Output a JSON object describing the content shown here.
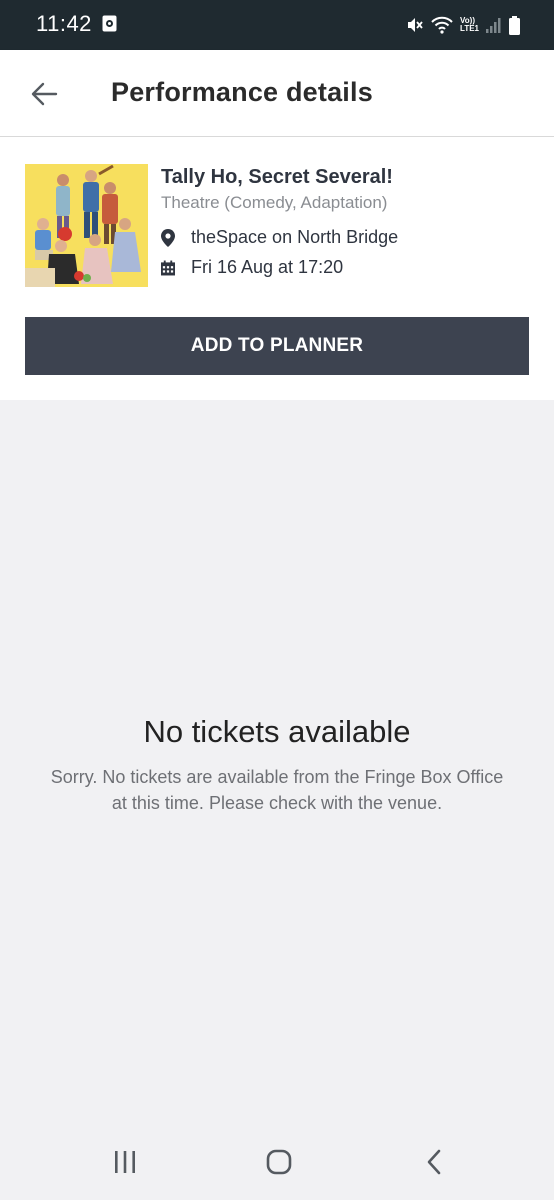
{
  "status_bar": {
    "time": "11:42",
    "network_label_top": "Vo))",
    "network_label_bottom": "LTE1"
  },
  "app_bar": {
    "title": "Performance details"
  },
  "performance": {
    "title": "Tally Ho, Secret Several!",
    "genre": "Theatre (Comedy, Adaptation)",
    "venue": "theSpace on North Bridge",
    "datetime": "Fri 16 Aug at 17:20",
    "add_button_label": "ADD TO PLANNER"
  },
  "empty_state": {
    "title": "No tickets available",
    "message": "Sorry. No tickets are available from the Fringe Box Office at this time. Please check with the venue."
  },
  "colors": {
    "status_bar_bg": "#1f2a30",
    "button_bg": "#3d4350",
    "page_bg": "#f1f1f3",
    "poster_bg": "#f7df5e"
  },
  "icons": {
    "back": "arrow-left-icon",
    "venue": "location-pin-icon",
    "date": "calendar-icon",
    "nav_recents": "recents-icon",
    "nav_home": "home-icon",
    "nav_back": "chevron-left-icon"
  }
}
